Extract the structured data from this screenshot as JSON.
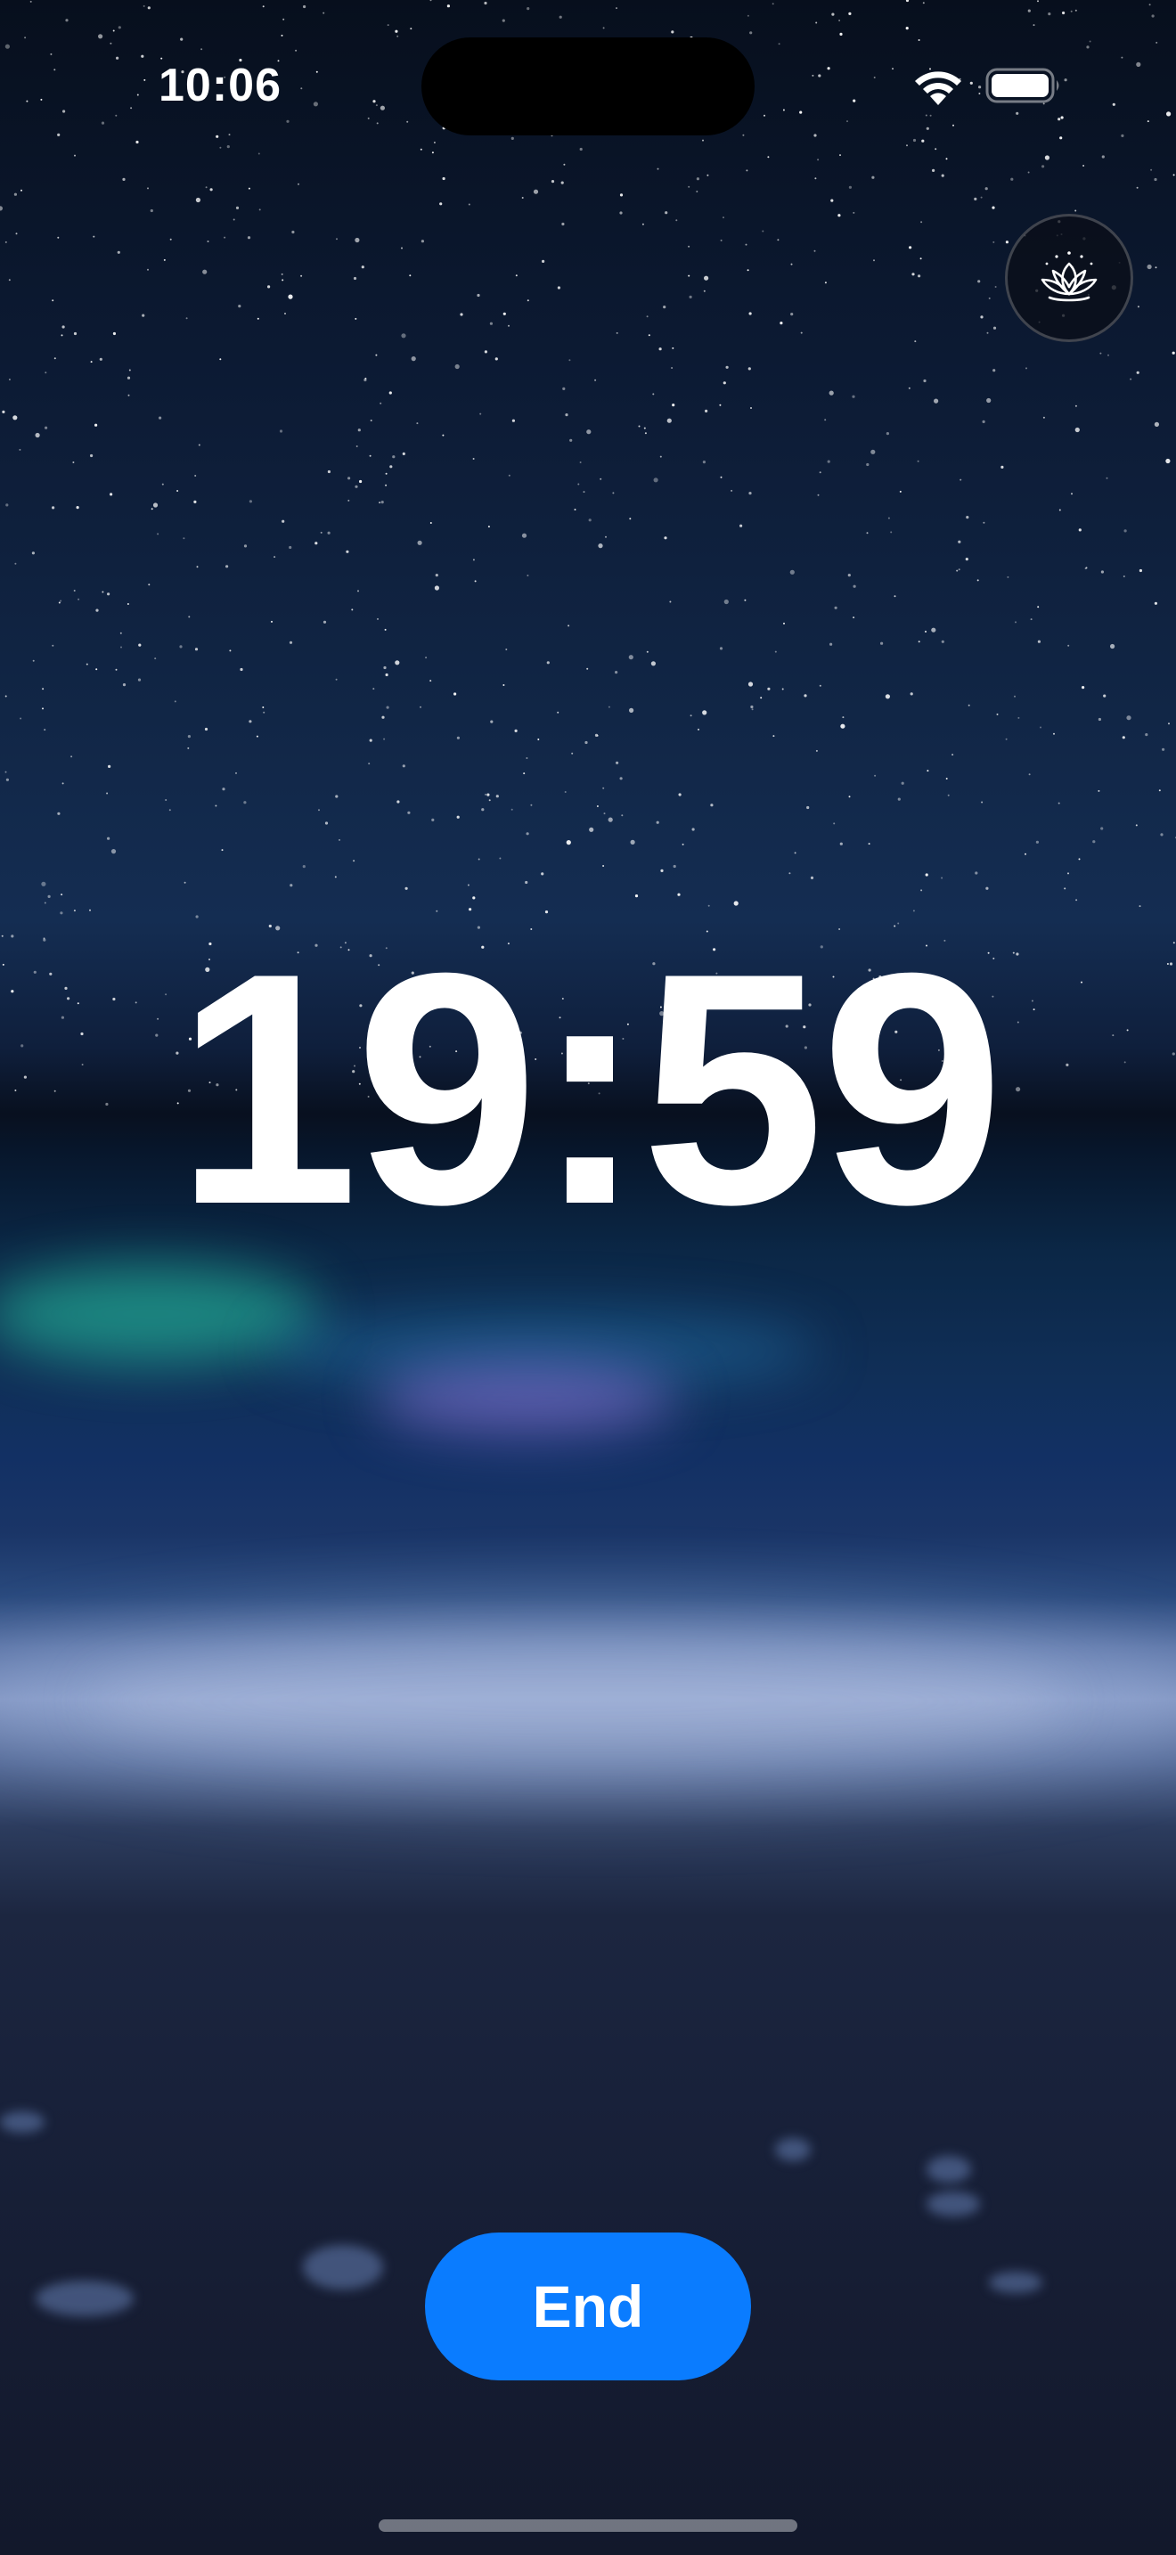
{
  "status_bar": {
    "time": "10:06",
    "wifi_icon": "wifi-icon",
    "battery_icon": "battery-icon"
  },
  "meditation_button": {
    "icon": "lotus-icon"
  },
  "timer": {
    "display": "19:59"
  },
  "actions": {
    "end_label": "End"
  },
  "colors": {
    "end_button": "#0a7cff",
    "timer_text": "#ffffff",
    "sky_top": "#070f1d",
    "sea_glow_green": "#28d2aa",
    "sea_glow_purple": "#9678e6"
  }
}
